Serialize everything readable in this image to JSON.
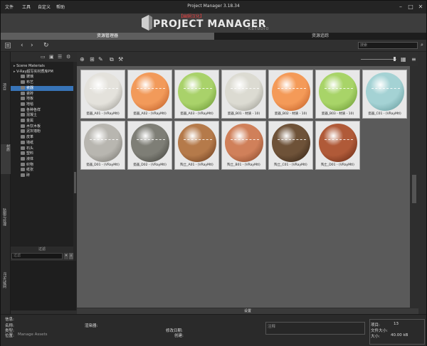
{
  "window": {
    "title": "Project Manager 3.18.34"
  },
  "menu": [
    "文件",
    "工具",
    "自定义",
    "帮助"
  ],
  "logo": {
    "subtitle": "【幽娴汉化】",
    "text": "PROJECT MANAGER",
    "version": "KSTUDIO"
  },
  "tabs": [
    "资源管理器",
    "资源追踪"
  ],
  "search": {
    "placeholder": "搜索"
  },
  "sidebar_tabs": [
    "项目",
    "材质",
    "贴图与纹理",
    "IES光域网"
  ],
  "tree": {
    "items": [
      {
        "label": "Scene Materials",
        "level": 0,
        "selected": false
      },
      {
        "label": "V-Ray超写实材质库PM",
        "level": 0,
        "selected": false
      },
      {
        "label": "玻璃",
        "level": 1,
        "selected": false
      },
      {
        "label": "布艺",
        "level": 1,
        "selected": false
      },
      {
        "label": "瓷器",
        "level": 1,
        "selected": true
      },
      {
        "label": "瓷砖",
        "level": 1,
        "selected": false
      },
      {
        "label": "地板",
        "level": 1,
        "selected": false
      },
      {
        "label": "地毯",
        "level": 1,
        "selected": false
      },
      {
        "label": "各种各样",
        "level": 1,
        "selected": false
      },
      {
        "label": "混凝土",
        "level": 1,
        "selected": false
      },
      {
        "label": "金属",
        "level": 1,
        "selected": false
      },
      {
        "label": "木饮木板",
        "level": 1,
        "selected": false
      },
      {
        "label": "泥灰墙粉",
        "level": 1,
        "selected": false
      },
      {
        "label": "皮革",
        "level": 1,
        "selected": false
      },
      {
        "label": "墙纸",
        "level": 1,
        "selected": false
      },
      {
        "label": "石头",
        "level": 1,
        "selected": false
      },
      {
        "label": "塑料",
        "level": 1,
        "selected": false
      },
      {
        "label": "液体",
        "level": 1,
        "selected": false
      },
      {
        "label": "织物",
        "level": 1,
        "selected": false
      },
      {
        "label": "纸张",
        "level": 1,
        "selected": false
      },
      {
        "label": "砖",
        "level": 1,
        "selected": false
      }
    ]
  },
  "filter": {
    "header": "过滤",
    "placeholder": "过滤"
  },
  "materials": [
    {
      "label": "瓷器_A01 - (VRayMtl)",
      "color": "#e4e2dc",
      "shade": "#8e8c86"
    },
    {
      "label": "瓷器_A02 - (VRayMtl)",
      "color": "#f29a5a",
      "shade": "#b4531f"
    },
    {
      "label": "瓷器_A03 - (VRayMtl)",
      "color": "#a9d26a",
      "shade": "#5e8a2a"
    },
    {
      "label": "瓷器_B01 - 材质 - 10)",
      "color": "#dcdbd2",
      "shade": "#8f8e86"
    },
    {
      "label": "瓷器_B02 - 材质 - 10)",
      "color": "#f49a58",
      "shade": "#b8541e"
    },
    {
      "label": "瓷器_B03 - 材质 - 10)",
      "color": "#a8d468",
      "shade": "#5f8c2a"
    },
    {
      "label": "瓷器_C01 - (VRayMtl)",
      "color": "#a4d2d4",
      "shade": "#5a9092"
    },
    {
      "label": "瓷器_D01 - (VRayMtl)",
      "color": "#b8b6b0",
      "shade": "#6e6c66"
    },
    {
      "label": "瓷器_D02 - (VRayMtl)",
      "color": "#7e7e76",
      "shade": "#3a3a34"
    },
    {
      "label": "陶土_A01 - (VRayMtl)",
      "color": "#b57a4a",
      "shade": "#5e3318"
    },
    {
      "label": "陶土_B01 - (VRayMtl)",
      "color": "#d0805a",
      "shade": "#7c3e22"
    },
    {
      "label": "陶土_C01 - (VRayMtl)",
      "color": "#6e5238",
      "shade": "#2c1c10"
    },
    {
      "label": "陶土_D01 - (VRayMtl)",
      "color": "#b05a38",
      "shade": "#5a2210"
    }
  ],
  "settings_bar": "设置",
  "info": {
    "header": "信息:",
    "name_label": "名称:",
    "type_label": "类型:",
    "location_label": "位置:",
    "location_value": "Manage Assets",
    "renderer_label": "渲染器:",
    "modified_label": "修改日期:",
    "size_label": "创建:",
    "notes_label": "注释",
    "count_label": "项目:",
    "count_value": "13",
    "total_label": "文件大小:",
    "filesize_label": "大小:",
    "filesize_value": "40.00 kB"
  }
}
